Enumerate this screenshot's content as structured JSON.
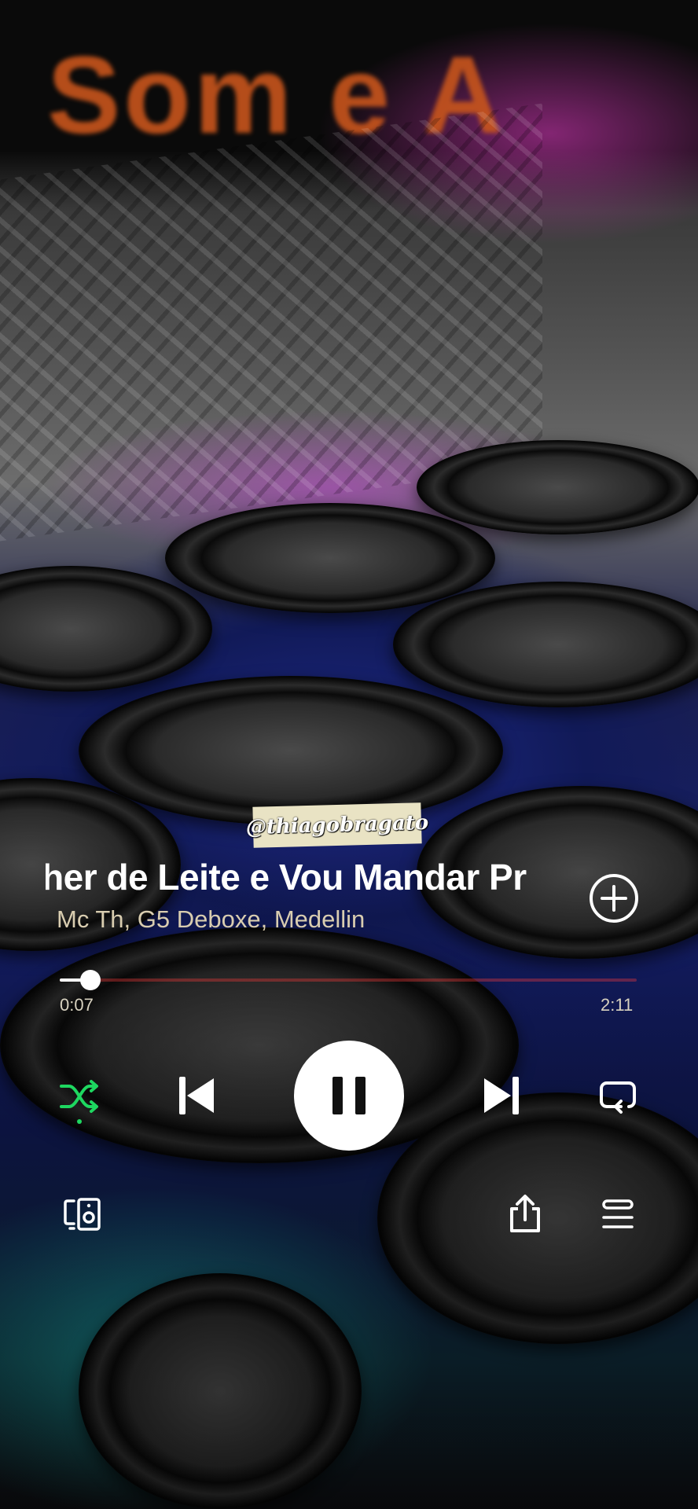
{
  "player": {
    "watermark": "@thiagobragato",
    "track_title": "cher de Leite e Vou Mandar Pr",
    "artists": "Mc Th, G5 Deboxe, Medellin",
    "progress": {
      "elapsed": "0:07",
      "duration": "2:11",
      "fraction": 0.053
    },
    "state": "playing",
    "shuffle_active": true,
    "colors": {
      "accent": "#1ed760",
      "artist_text": "#d9cdb0",
      "button_bg": "#ffffff"
    },
    "icons": {
      "add": "plus-circle-icon",
      "shuffle": "shuffle-icon",
      "previous": "skip-previous-icon",
      "play_pause": "pause-icon",
      "next": "skip-next-icon",
      "repeat": "repeat-icon",
      "devices": "connect-device-icon",
      "share": "share-icon",
      "queue": "queue-icon"
    }
  },
  "background": {
    "sign_text": "Som e A"
  }
}
